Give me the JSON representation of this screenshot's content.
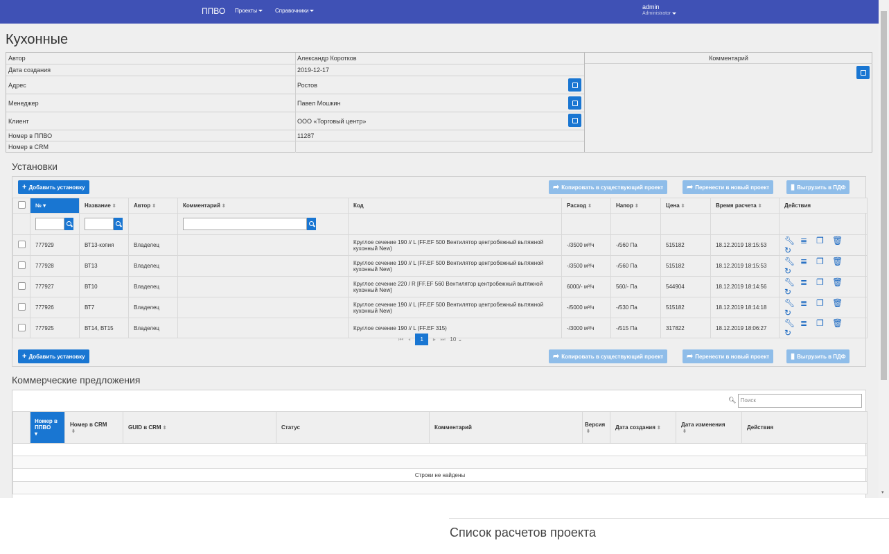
{
  "nav": {
    "brand": "ППВО",
    "projects": "Проекты",
    "directories": "Справочники",
    "user_name": "admin",
    "user_role": "Administrator"
  },
  "page_title": "Кухонные",
  "info": {
    "rows": [
      {
        "label": "Автор",
        "value": "Александр Коротков"
      },
      {
        "label": "Дата создания",
        "value": "2019-12-17"
      },
      {
        "label": "Адрес",
        "value": "Ростов"
      },
      {
        "label": "Менеджер",
        "value": "Павел Мошкин"
      },
      {
        "label": "Клиент",
        "value": "ООО «Торговый центр»"
      },
      {
        "label": "Номер в ППВО",
        "value": "11287"
      },
      {
        "label": "Номер в CRM",
        "value": ""
      }
    ],
    "comment_header": "Комментарий"
  },
  "installations": {
    "title": "Установки",
    "add_button": "Добавить установку",
    "copy_button": "Копировать в существующий проект",
    "move_button": "Перенести в новый проект",
    "export_button": "Выгрузить в ПДФ",
    "columns": [
      "№",
      "Название",
      "Автор",
      "Комментарий",
      "Код",
      "Расход",
      "Напор",
      "Цена",
      "Время расчета",
      "Действия"
    ],
    "rows": [
      {
        "num": "777929",
        "name": "ВТ13-копия",
        "author": "Владелец",
        "comment": "",
        "code": "Круглое сечение 190 // L (FF.EF 500 Вентилятор центробежный вытяжной кухонный New)",
        "flow": "-/3500 м³/ч",
        "pressure": "-/560 Па",
        "price": "515182",
        "time": "18.12.2019 18:15:53"
      },
      {
        "num": "777928",
        "name": "ВТ13",
        "author": "Владелец",
        "comment": "",
        "code": "Круглое сечение 190 // L (FF.EF 500 Вентилятор центробежный вытяжной кухонный New)",
        "flow": "-/3500 м³/ч",
        "pressure": "-/560 Па",
        "price": "515182",
        "time": "18.12.2019 18:15:53"
      },
      {
        "num": "777927",
        "name": "ВТ10",
        "author": "Владелец",
        "comment": "",
        "code": "Круглое сечение 220 / R [FF.EF 560 Вентилятор центробежный вытяжной кухонный New]",
        "flow": "6000/- м³/ч",
        "pressure": "560/- Па",
        "price": "544904",
        "time": "18.12.2019 18:14:56"
      },
      {
        "num": "777926",
        "name": "ВТ7",
        "author": "Владелец",
        "comment": "",
        "code": "Круглое сечение 190 // L (FF.EF 500 Вентилятор центробежный вытяжной кухонный New)",
        "flow": "-/5000 м³/ч",
        "pressure": "-/530 Па",
        "price": "515182",
        "time": "18.12.2019 18:14:18"
      },
      {
        "num": "777925",
        "name": "ВТ14, ВТ15",
        "author": "Владелец",
        "comment": "",
        "code": "Круглое сечение 190 // L (FF.EF 315)",
        "flow": "-/3000 м³/ч",
        "pressure": "-/515 Па",
        "price": "317822",
        "time": "18.12.2019 18:06:27"
      }
    ],
    "page": "1",
    "page_size": "10"
  },
  "proposals": {
    "title": "Коммерческие предложения",
    "search_placeholder": "Поиск",
    "columns": [
      "Номер в ППВО",
      "Номер в CRM",
      "GUID в CRM",
      "Статус",
      "Комментарий",
      "Версия",
      "Дата создания",
      "Дата изменения",
      "Действия"
    ],
    "empty_text": "Строки не найдены"
  },
  "footer_title": "Список расчетов проекта"
}
